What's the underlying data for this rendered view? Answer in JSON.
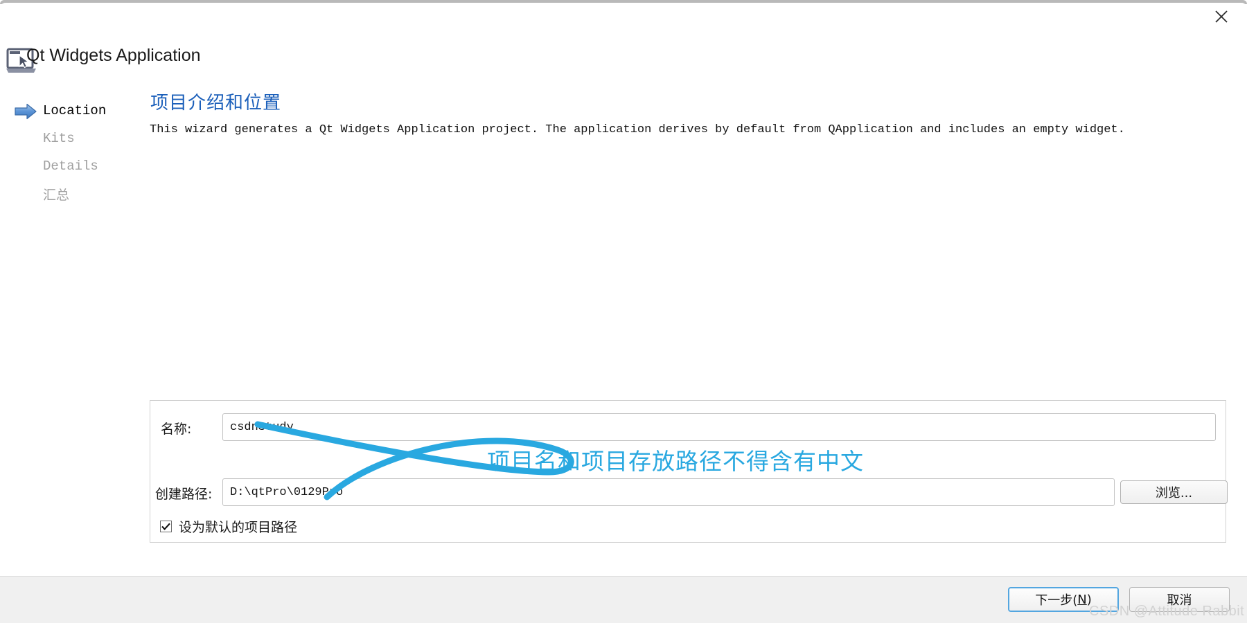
{
  "window": {
    "close_icon": "close-icon"
  },
  "header": {
    "app_icon": "laptop-cursor-icon",
    "title": "Qt Widgets Application"
  },
  "sidebar": {
    "arrow_icon": "blue-right-arrow-icon",
    "items": [
      {
        "label": "Location",
        "state": "active"
      },
      {
        "label": "Kits",
        "state": "inactive"
      },
      {
        "label": "Details",
        "state": "inactive"
      },
      {
        "label": "汇总",
        "state": "inactive"
      }
    ]
  },
  "main": {
    "heading": "项目介绍和位置",
    "description": "This wizard generates a Qt Widgets Application project. The application derives by default from QApplication and includes an empty widget."
  },
  "form": {
    "name_label": "名称:",
    "name_value": "csdnStudy",
    "name_placeholder": "",
    "path_label": "创建路径:",
    "path_value": "D:\\qtPro\\0129Pro",
    "path_placeholder": "",
    "browse_label": "浏览...",
    "default_path_label": "设为默认的项目路径",
    "default_path_checked": true,
    "check_icon": "check-icon"
  },
  "annotation": {
    "text": "项目名和项目存放路径不得含有中文",
    "color": "#29a8e0"
  },
  "footer": {
    "next_label_main": "下一步(",
    "next_accel": "N",
    "next_label_end": ")",
    "cancel_label": "取消",
    "watermark": "CSDN @Attitude Rabbit"
  },
  "colors": {
    "heading_blue": "#1b5fba",
    "annotation_blue": "#29a8e0",
    "default_button_border": "#53a6e0",
    "bottom_bar": "#f0f0f0"
  }
}
